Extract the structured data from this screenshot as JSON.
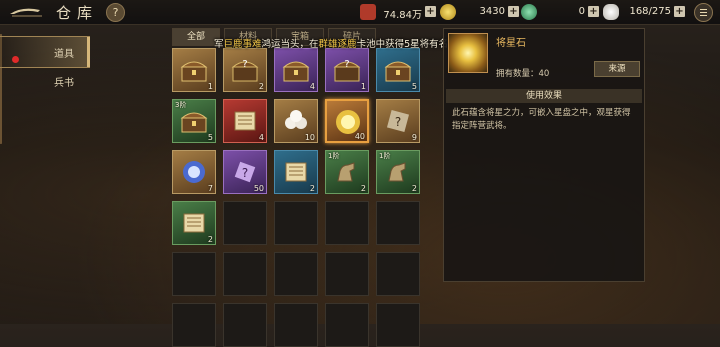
{
  "header": {
    "title": "仓库",
    "help": "?",
    "resources": [
      {
        "name": "treasure-chest",
        "value": "74.84万",
        "color": "#b03a2a"
      },
      {
        "name": "gold-coin",
        "value": "3430",
        "color": "#d8b040"
      },
      {
        "name": "jade-coin",
        "value": "0",
        "color": "#3e9a6a"
      },
      {
        "name": "capacity",
        "value": "168/275",
        "color": "#e8e4dc"
      }
    ],
    "plus": "+"
  },
  "sidebar": {
    "items": [
      {
        "label": "道具",
        "active": true
      },
      {
        "label": "兵书",
        "active": false
      }
    ]
  },
  "tabs": [
    {
      "label": "全部",
      "active": true
    },
    {
      "label": "材料",
      "active": false
    },
    {
      "label": "宝箱",
      "active": false
    },
    {
      "label": "碎片",
      "active": false
    }
  ],
  "tip": {
    "p1": "军",
    "hl1": "巨鹿事难",
    "p2": "鸿运当头，在",
    "hl2": "群雄逐鹿",
    "p3": "卡池中获得5星将有名"
  },
  "grid": [
    {
      "quality": "brown",
      "count": "1",
      "icon": "chest-icon"
    },
    {
      "quality": "brown",
      "count": "2",
      "icon": "mystery-chest-icon"
    },
    {
      "quality": "purple",
      "count": "4",
      "icon": "chest-icon"
    },
    {
      "quality": "purple",
      "count": "1",
      "icon": "mystery-chest-icon"
    },
    {
      "quality": "blue",
      "count": "5",
      "icon": "chest-icon"
    },
    {
      "quality": "green",
      "count": "5",
      "icon": "chest-icon",
      "level": "3阶"
    },
    {
      "quality": "red",
      "count": "4",
      "icon": "scroll-icon"
    },
    {
      "quality": "brown",
      "count": "10",
      "icon": "pearls-icon"
    },
    {
      "quality": "orange",
      "count": "40",
      "icon": "star-stone-icon",
      "selected": true
    },
    {
      "quality": "brown",
      "count": "9",
      "icon": "mystery-token-icon"
    },
    {
      "quality": "brown",
      "count": "7",
      "icon": "orb-icon"
    },
    {
      "quality": "purple",
      "count": "50",
      "icon": "mystery-shard-icon"
    },
    {
      "quality": "blue",
      "count": "2",
      "icon": "scroll-icon"
    },
    {
      "quality": "green",
      "count": "2",
      "icon": "horse-icon",
      "level": "1阶"
    },
    {
      "quality": "green",
      "count": "2",
      "icon": "horse-icon",
      "level": "1阶"
    },
    {
      "quality": "green",
      "count": "2",
      "icon": "scroll-icon"
    }
  ],
  "detail": {
    "name": "将星石",
    "owned": "拥有数量：40",
    "source_btn": "来源",
    "effect_header": "使用效果",
    "description": "此石蕴含将星之力，可嵌入星盘之中，观星获得指定阵营武将。"
  }
}
